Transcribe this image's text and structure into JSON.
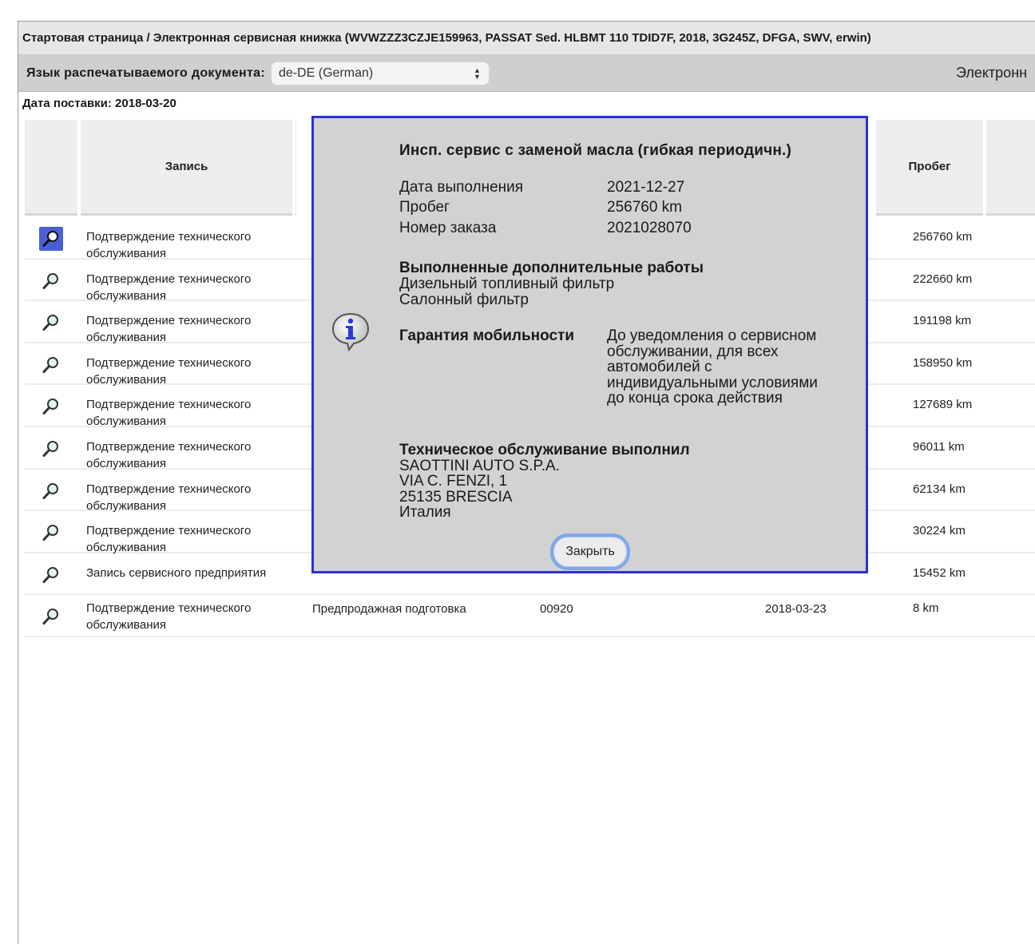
{
  "breadcrumb": "Стартовая страница / Электронная сервисная книжка (WVWZZZ3CZJE159963, PASSAT Sed. HLBMT 110 TDID7F, 2018, 3G245Z, DFGA, SWV, erwin)",
  "toolbar": {
    "language_label": "Язык распечатываемого документа:",
    "language_value": "de-DE (German)",
    "right_text": "Электронн"
  },
  "delivery_date": "Дата поставки: 2018-03-20",
  "table": {
    "headers": {
      "entry": "Запись",
      "mileage": "Пробег"
    },
    "rows": [
      {
        "entry": "Подтверждение технического обслуживания",
        "mileage": "256760 km"
      },
      {
        "entry": "Подтверждение технического обслуживания",
        "mileage": "222660 km"
      },
      {
        "entry": "Подтверждение технического обслуживания",
        "mileage": "191198 km"
      },
      {
        "entry": "Подтверждение технического обслуживания",
        "mileage": "158950 km"
      },
      {
        "entry": "Подтверждение технического обслуживания",
        "mileage": "127689 km"
      },
      {
        "entry": "Подтверждение технического обслуживания",
        "mileage": "96011 km"
      },
      {
        "entry": "Подтверждение технического обслуживания",
        "mileage": "62134 km"
      },
      {
        "entry": "Подтверждение технического обслуживания",
        "mileage": "30224 km"
      },
      {
        "entry": "Запись сервисного предприятия",
        "mileage": "15452 km"
      },
      {
        "entry": "Подтверждение технического обслуживания",
        "description": "Предпродажная подготовка",
        "number": "00920",
        "date": "2018-03-23",
        "mileage": "8 km"
      }
    ]
  },
  "modal": {
    "title": "Инсп. сервис с заменой масла (гибкая периодичн.)",
    "fields": [
      {
        "label": "Дата выполнения",
        "value": "2021-12-27"
      },
      {
        "label": "Пробег",
        "value": "256760 km"
      },
      {
        "label": "Номер заказа",
        "value": "2021028070"
      }
    ],
    "additional_work_title": "Выполненные дополнительные работы",
    "additional_work": [
      "Дизельный топливный фильтр",
      "Салонный фильтр"
    ],
    "mobility_title": "Гарантия мобильности",
    "mobility_text": "До уведомления о сервисном обслуживании, для всех автомобилей с индивидуальными условиями до конца срока действия",
    "performer_title": "Техническое обслуживание выполнил",
    "performer_lines": [
      "SAOTTINI AUTO S.P.A.",
      "VIA C. FENZI, 1",
      "25135 BRESCIA",
      "Италия"
    ],
    "close_label": "Закрыть"
  }
}
